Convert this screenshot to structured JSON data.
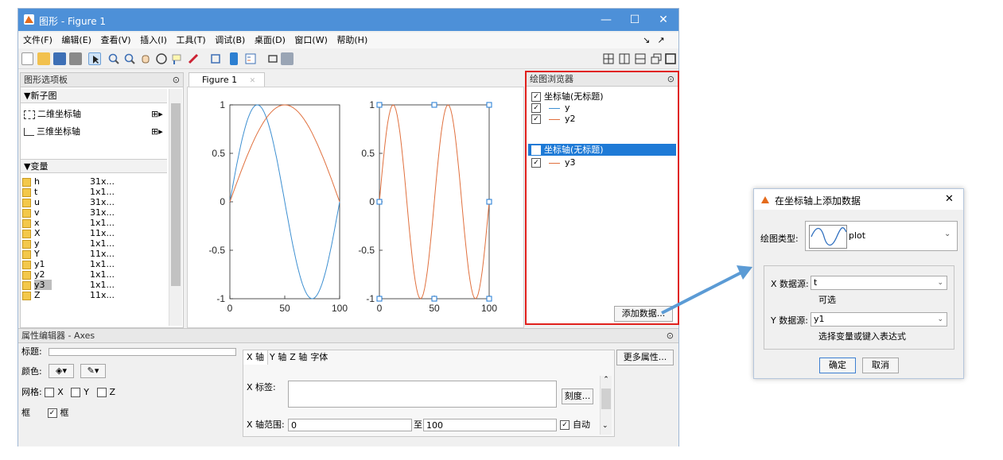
{
  "window": {
    "title": "图形 - Figure 1",
    "controls": [
      "—",
      "☐",
      "✕"
    ],
    "menu": [
      "文件(F)",
      "编辑(E)",
      "查看(V)",
      "插入(I)",
      "工具(T)",
      "调试(B)",
      "桌面(D)",
      "窗口(W)",
      "帮助(H)"
    ],
    "menu_right": [
      "↘",
      "↗",
      "✕"
    ]
  },
  "palette": {
    "title": "图形选项板",
    "new_subplot_header": "▼新子图",
    "axes2d": "二维坐标轴",
    "axes3d": "三维坐标轴",
    "variables_header": "▼变量",
    "variables": [
      {
        "name": "h",
        "size": "31x..."
      },
      {
        "name": "t",
        "size": "1x1..."
      },
      {
        "name": "u",
        "size": "31x..."
      },
      {
        "name": "v",
        "size": "31x..."
      },
      {
        "name": "x",
        "size": "1x1..."
      },
      {
        "name": "X",
        "size": "11x..."
      },
      {
        "name": "y",
        "size": "1x1..."
      },
      {
        "name": "Y",
        "size": "11x..."
      },
      {
        "name": "y1",
        "size": "1x1..."
      },
      {
        "name": "y2",
        "size": "1x1..."
      },
      {
        "name": "y3",
        "size": "1x1..."
      },
      {
        "name": "Z",
        "size": "11x..."
      }
    ]
  },
  "figure_tab": {
    "label": "Figure 1",
    "close": "✕"
  },
  "plot_browser": {
    "title": "绘图浏览器",
    "axes1": {
      "label": "坐标轴(无标题)",
      "lines": [
        {
          "name": "y",
          "color": "#3d8fd1"
        },
        {
          "name": "y2",
          "color": "#e0703e"
        }
      ]
    },
    "axes2": {
      "label": "坐标轴(无标题)",
      "lines": [
        {
          "name": "y3",
          "color": "#e0703e"
        }
      ]
    },
    "add_data_button": "添加数据..."
  },
  "chart_data": [
    {
      "type": "line",
      "xlim": [
        0,
        100
      ],
      "ylim": [
        -1,
        1
      ],
      "xticks": [
        "0",
        "50",
        "100"
      ],
      "yticks": [
        "1",
        "0.5",
        "0",
        "-0.5",
        "-1"
      ],
      "series": [
        {
          "name": "y",
          "color": "#3d8fd1",
          "x": [
            0,
            12.5,
            25,
            37.5,
            50,
            62.5,
            75,
            87.5,
            100
          ],
          "values": [
            0,
            0.71,
            1,
            0.71,
            0,
            -0.71,
            -1,
            -0.71,
            0
          ]
        },
        {
          "name": "y2",
          "color": "#e0703e",
          "x": [
            0,
            25,
            50,
            75,
            100
          ],
          "values": [
            0,
            0.71,
            1,
            0.71,
            0
          ]
        }
      ]
    },
    {
      "type": "line",
      "xlim": [
        0,
        100
      ],
      "ylim": [
        -1,
        1
      ],
      "xticks": [
        "0",
        "50",
        "100"
      ],
      "yticks": [
        "1",
        "0.5",
        "0",
        "-0.5",
        "-1"
      ],
      "series": [
        {
          "name": "y3",
          "color": "#e0703e",
          "x": [
            0,
            12.5,
            25,
            37.5,
            50,
            62.5,
            75,
            87.5,
            100
          ],
          "values": [
            0,
            1,
            0,
            -1,
            0,
            1,
            0,
            -1,
            0
          ]
        }
      ]
    }
  ],
  "property_editor": {
    "title": "属性编辑器 - Axes",
    "title_label": "标题:",
    "color_label": "颜色:",
    "grid_label": "网格:",
    "grid_x": "X",
    "grid_y": "Y",
    "grid_z": "Z",
    "box_label": "框",
    "box_check": "框",
    "tabs": [
      "X 轴",
      "Y 轴",
      "Z 轴",
      "字体"
    ],
    "xlabel_label": "X 标签:",
    "ticks_button": "刻度...",
    "xrange_label": "X 轴范围:",
    "xrange_from": "0",
    "xrange_to_label": "至",
    "xrange_to": "100",
    "auto_label": "自动",
    "more_button": "更多属性..."
  },
  "dialog": {
    "title": "在坐标轴上添加数据",
    "close": "✕",
    "plot_type_label": "绘图类型:",
    "plot_type_value": "plot",
    "x_source_label": "X 数据源:",
    "x_source_value": "t",
    "x_hint": "可选",
    "y_source_label": "Y 数据源:",
    "y_source_value": "y1",
    "y_hint": "选择变量或键入表达式",
    "ok_button": "确定",
    "cancel_button": "取消"
  }
}
